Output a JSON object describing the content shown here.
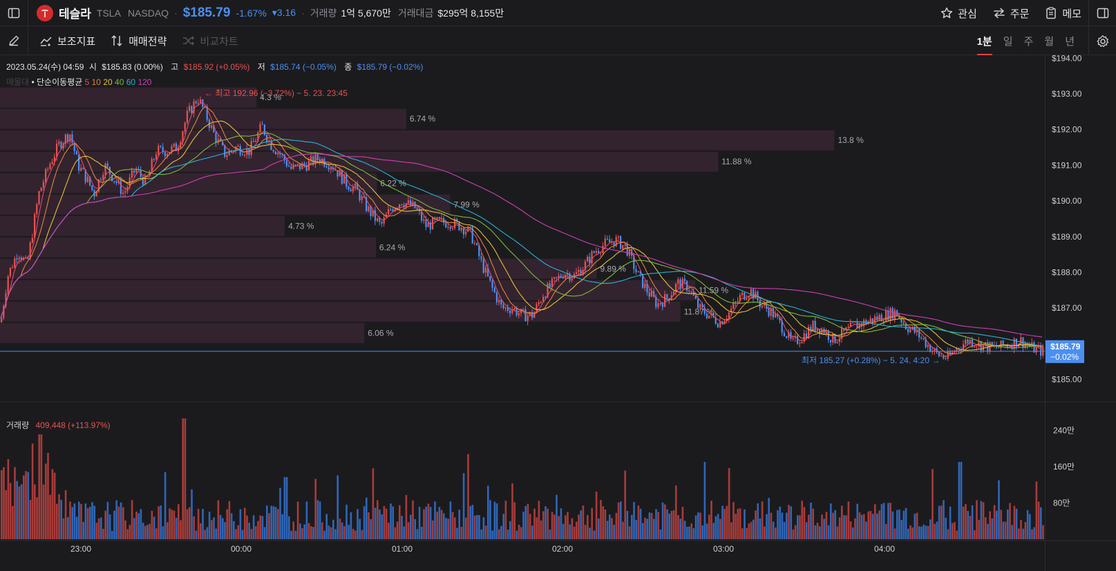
{
  "header": {
    "name": "테슬라",
    "ticker": "TSLA",
    "exchange": "NASDAQ",
    "price": "$185.79",
    "change_pct": "-1.67%",
    "change_abs": "▾3.16",
    "volume_label": "거래량",
    "volume_value": "1억 5,670만",
    "amount_label": "거래대금",
    "amount_value": "$295억 8,155만",
    "watch_label": "관심",
    "order_label": "주문",
    "memo_label": "메모"
  },
  "toolbar": {
    "indicators_label": "보조지표",
    "strategy_label": "매매전략",
    "compare_label": "비교차트",
    "periods": [
      "1분",
      "일",
      "주",
      "월",
      "년"
    ],
    "active_period": "1분"
  },
  "info": {
    "datetime": "2023.05.24(수) 04:59",
    "open_label": "시",
    "open_value": "$185.83 (0.00%)",
    "high_label": "고",
    "high_value": "$185.92 (+0.05%)",
    "low_label": "저",
    "low_value": "$185.74 (−0.05%)",
    "close_label": "종",
    "close_value": "$185.79 (−0.02%)",
    "band_label": "매물대",
    "ma_label": "• 단순이동평균",
    "ma_periods": [
      "5",
      "10",
      "20",
      "40",
      "60",
      "120"
    ]
  },
  "colors": {
    "up": "#e8534e",
    "down": "#4c8ff0",
    "ma": [
      "#e14b6e",
      "#e8823a",
      "#e3c233",
      "#7cbc3a",
      "#29b4d8",
      "#d23fb4"
    ],
    "band": "#33232f",
    "background": "#1b1b1e"
  },
  "volume": {
    "label": "거래량",
    "value": "409,448 (+113.97%)",
    "axis_ticks": [
      "240만",
      "160만",
      "80만"
    ]
  },
  "chart_data": {
    "type": "candlestick",
    "price_axis": [
      "$194.00",
      "$193.00",
      "$192.00",
      "$191.00",
      "$190.00",
      "$189.00",
      "$188.00",
      "$187.00",
      "$185.00"
    ],
    "current_price_tag": [
      "$185.79",
      "−0.02%"
    ],
    "time_axis": [
      "23:00",
      "00:00",
      "01:00",
      "02:00",
      "03:00",
      "04:00"
    ],
    "high_annotation": "← 최고 192.96 (−3.72%) − 5. 23. 23:45",
    "low_annotation": "최저 185.27 (+0.28%) − 5. 24. 4:20 →",
    "volume_profile": [
      {
        "price_top": 193.2,
        "pct": "4.3 %",
        "length": 0.245
      },
      {
        "price_top": 192.6,
        "pct": "6.74 %",
        "length": 0.388
      },
      {
        "price_top": 192.0,
        "pct": "13.8 %",
        "length": 0.797
      },
      {
        "price_top": 191.4,
        "pct": "11.88 %",
        "length": 0.686
      },
      {
        "price_top": 190.8,
        "pct": "6.22 %",
        "length": 0.36
      },
      {
        "price_top": 190.2,
        "pct": "7.99 %",
        "length": 0.43
      },
      {
        "price_top": 189.6,
        "pct": "4.73 %",
        "length": 0.272
      },
      {
        "price_top": 189.0,
        "pct": "6.24 %",
        "length": 0.359
      },
      {
        "price_top": 188.4,
        "pct": "9.89 %",
        "length": 0.57
      },
      {
        "price_top": 187.8,
        "pct": "11.59 %",
        "length": 0.664
      },
      {
        "price_top": 187.2,
        "pct": "11.87 %",
        "length": 0.65
      },
      {
        "price_top": 186.6,
        "pct": "6.06 %",
        "length": 0.348
      }
    ],
    "price_path": [
      [
        0,
        186.6
      ],
      [
        10,
        187.9
      ],
      [
        25,
        188.6
      ],
      [
        38,
        188.2
      ],
      [
        55,
        190.2
      ],
      [
        70,
        191.0
      ],
      [
        85,
        191.6
      ],
      [
        100,
        191.9
      ],
      [
        112,
        191.0
      ],
      [
        125,
        190.6
      ],
      [
        135,
        190.2
      ],
      [
        150,
        191.0
      ],
      [
        165,
        190.6
      ],
      [
        178,
        190.2
      ],
      [
        195,
        190.9
      ],
      [
        210,
        190.5
      ],
      [
        225,
        191.4
      ],
      [
        240,
        191.4
      ],
      [
        255,
        191.5
      ],
      [
        270,
        192.4
      ],
      [
        285,
        192.9
      ],
      [
        295,
        192.5
      ],
      [
        310,
        191.8
      ],
      [
        325,
        191.3
      ],
      [
        340,
        191.5
      ],
      [
        360,
        191.4
      ],
      [
        378,
        192.1
      ],
      [
        390,
        191.6
      ],
      [
        405,
        191.3
      ],
      [
        420,
        190.9
      ],
      [
        440,
        191.0
      ],
      [
        460,
        191.2
      ],
      [
        480,
        191.0
      ],
      [
        500,
        190.5
      ],
      [
        515,
        190.3
      ],
      [
        530,
        189.8
      ],
      [
        550,
        189.3
      ],
      [
        565,
        189.8
      ],
      [
        580,
        190.0
      ],
      [
        600,
        189.8
      ],
      [
        615,
        189.3
      ],
      [
        630,
        189.4
      ],
      [
        650,
        189.4
      ],
      [
        665,
        189.3
      ],
      [
        680,
        189.1
      ],
      [
        695,
        188.3
      ],
      [
        710,
        187.6
      ],
      [
        725,
        187.0
      ],
      [
        740,
        187.0
      ],
      [
        755,
        186.8
      ],
      [
        770,
        186.8
      ],
      [
        785,
        187.4
      ],
      [
        800,
        187.7
      ],
      [
        815,
        188.0
      ],
      [
        830,
        187.9
      ],
      [
        845,
        188.2
      ],
      [
        860,
        188.6
      ],
      [
        875,
        188.8
      ],
      [
        890,
        188.9
      ],
      [
        905,
        188.7
      ],
      [
        920,
        188.0
      ],
      [
        935,
        187.5
      ],
      [
        950,
        187.1
      ],
      [
        965,
        187.3
      ],
      [
        980,
        187.7
      ],
      [
        995,
        187.6
      ],
      [
        1010,
        187.0
      ],
      [
        1025,
        186.8
      ],
      [
        1040,
        186.6
      ],
      [
        1055,
        186.9
      ],
      [
        1070,
        187.3
      ],
      [
        1085,
        187.5
      ],
      [
        1100,
        187.1
      ],
      [
        1115,
        186.9
      ],
      [
        1130,
        186.5
      ],
      [
        1145,
        186.0
      ],
      [
        1160,
        186.2
      ],
      [
        1175,
        186.5
      ],
      [
        1190,
        186.4
      ],
      [
        1205,
        186.1
      ],
      [
        1220,
        186.3
      ],
      [
        1235,
        186.5
      ],
      [
        1250,
        186.6
      ],
      [
        1265,
        186.7
      ],
      [
        1280,
        186.8
      ],
      [
        1295,
        186.9
      ],
      [
        1310,
        186.5
      ],
      [
        1325,
        186.3
      ],
      [
        1340,
        186.0
      ],
      [
        1355,
        185.7
      ],
      [
        1370,
        185.6
      ],
      [
        1385,
        185.9
      ],
      [
        1400,
        186.1
      ],
      [
        1415,
        186.0
      ],
      [
        1430,
        185.9
      ],
      [
        1445,
        185.9
      ],
      [
        1460,
        186.0
      ],
      [
        1475,
        186.1
      ],
      [
        1490,
        185.9
      ],
      [
        1505,
        185.8
      ],
      [
        1512,
        185.8
      ]
    ]
  }
}
